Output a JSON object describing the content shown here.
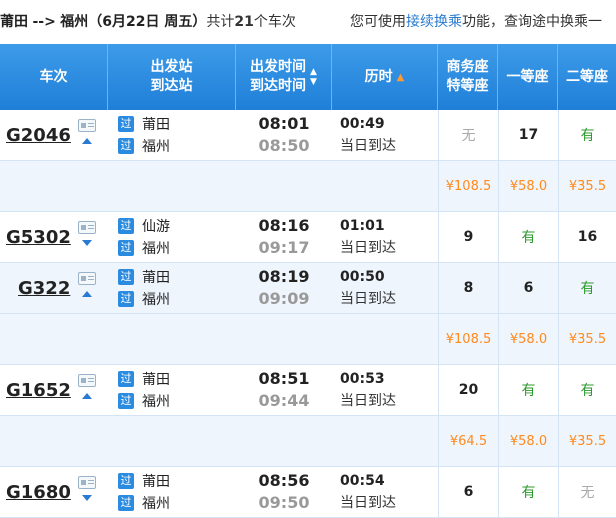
{
  "topbar": {
    "from": "莆田",
    "arrow": "-->",
    "to": "福州",
    "date_info": "（6月22日  周五）",
    "count_prefix": "共计",
    "count": "21",
    "count_suffix": "个车次",
    "hint_prefix": "您可使用",
    "hint_link": "接续换乘",
    "hint_suffix": "功能，查询途中换乘一"
  },
  "header": {
    "train_no": "车次",
    "station_top": "出发站",
    "station_bottom": "到达站",
    "time_top": "出发时间",
    "time_bottom": "到达时间",
    "duration": "历时",
    "business_top": "商务座",
    "business_bottom": "特等座",
    "first_class": "一等座",
    "second_class": "二等座"
  },
  "colors": {
    "header_bg": "#1f7fd8",
    "available": "#2e9a2e",
    "price": "#ff8a1e",
    "badge": "#2a8be0"
  },
  "rows": [
    {
      "train": "G2046",
      "arrow": "up",
      "badge1": "过",
      "badge2": "过",
      "from": "莆田",
      "to": "福州",
      "dep": "08:01",
      "arr": "08:50",
      "duration": "00:49",
      "arrival_day": "当日到达",
      "business": "无",
      "first": "17",
      "second": "有"
    },
    {
      "price_business": "¥108.5",
      "price_first": "¥58.0",
      "price_second": "¥35.5"
    },
    {
      "train": "G5302",
      "arrow": "down",
      "badge1": "过",
      "badge2": "过",
      "from": "仙游",
      "to": "福州",
      "dep": "08:16",
      "arr": "09:17",
      "duration": "01:01",
      "arrival_day": "当日到达",
      "business": "9",
      "first": "有",
      "second": "16"
    },
    {
      "train": "G322",
      "arrow": "up",
      "badge1": "过",
      "badge2": "过",
      "from": "莆田",
      "to": "福州",
      "dep": "08:19",
      "arr": "09:09",
      "duration": "00:50",
      "arrival_day": "当日到达",
      "business": "8",
      "first": "6",
      "second": "有"
    },
    {
      "price_business": "¥108.5",
      "price_first": "¥58.0",
      "price_second": "¥35.5"
    },
    {
      "train": "G1652",
      "arrow": "up",
      "badge1": "过",
      "badge2": "过",
      "from": "莆田",
      "to": "福州",
      "dep": "08:51",
      "arr": "09:44",
      "duration": "00:53",
      "arrival_day": "当日到达",
      "business": "20",
      "first": "有",
      "second": "有"
    },
    {
      "price_business": "¥64.5",
      "price_first": "¥58.0",
      "price_second": "¥35.5"
    },
    {
      "train": "G1680",
      "arrow": "down",
      "badge1": "过",
      "badge2": "过",
      "from": "莆田",
      "to": "福州",
      "dep": "08:56",
      "arr": "09:50",
      "duration": "00:54",
      "arrival_day": "当日到达",
      "business": "6",
      "first": "有",
      "second": "无"
    }
  ]
}
